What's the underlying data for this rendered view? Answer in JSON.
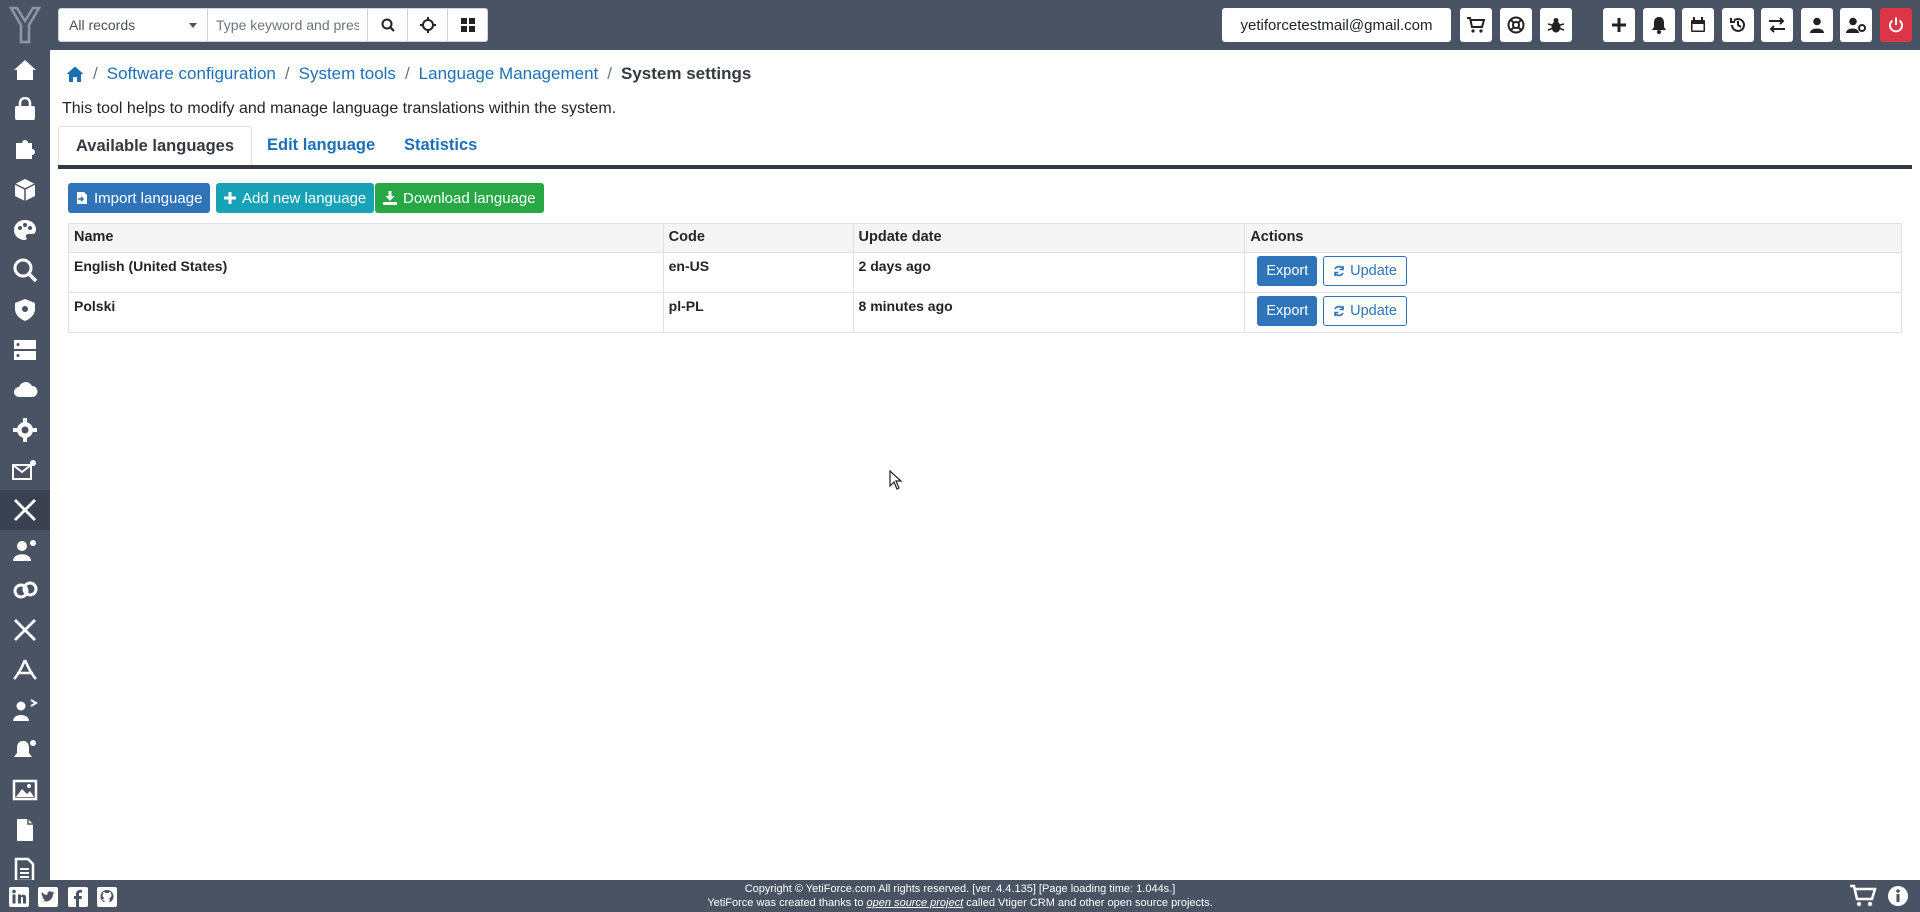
{
  "header": {
    "search": {
      "scope": "All records",
      "placeholder": "Type keyword and press"
    },
    "user_email": "yetiforcetestmail@gmail.com"
  },
  "breadcrumb": [
    "Software configuration",
    "System tools",
    "Language Management",
    "System settings"
  ],
  "description": "This tool helps to modify and manage language translations within the system.",
  "tabs": [
    "Available languages",
    "Edit language",
    "Statistics"
  ],
  "toolbar": {
    "import_label": "Import language",
    "add_label": "Add new language",
    "download_label": "Download language"
  },
  "table": {
    "headers": [
      "Name",
      "Code",
      "Update date",
      "Actions"
    ],
    "rows": [
      {
        "name": "English (United States)",
        "code": "en-US",
        "updated": "2 days ago",
        "export": "Export",
        "update": "Update"
      },
      {
        "name": "Polski",
        "code": "pl-PL",
        "updated": "8 minutes ago",
        "export": "Export",
        "update": "Update"
      }
    ]
  },
  "footer": {
    "copyright": "Copyright © YetiForce.com All rights reserved. [ver. 4.4.135] [Page loading time: 1.044s.]",
    "credits_pre": "YetiForce was created thanks to",
    "credits_link": "open source project",
    "credits_post": "called Vtiger CRM and other open source projects."
  },
  "colors": {
    "bar": "#4a5364",
    "link": "#1d6fb8",
    "primary": "#2f74b8",
    "info": "#17a2b8",
    "success": "#28a745",
    "danger": "#dc3545"
  }
}
